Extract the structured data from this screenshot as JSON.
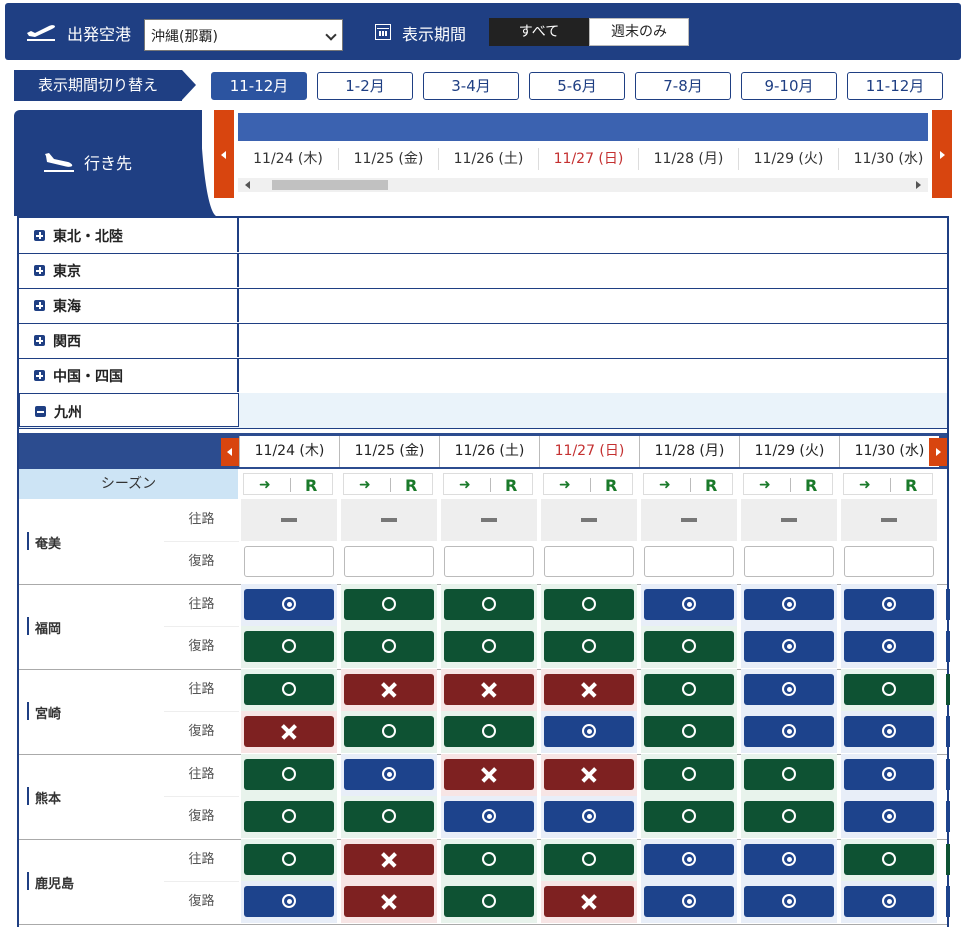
{
  "topbar": {
    "departure_label": "出発空港",
    "airport_value": "沖縄(那覇)",
    "period_label": "表示期間",
    "seg_all": "すべて",
    "seg_weekend": "週末のみ"
  },
  "period": {
    "label": "表示期間切り替え",
    "months": [
      "11-12月",
      "1-2月",
      "3-4月",
      "5-6月",
      "7-8月",
      "9-10月",
      "11-12月"
    ],
    "active_index": 0
  },
  "dest_head_label": "行き先",
  "dates": [
    {
      "label": "11/24 (木)",
      "holiday": false
    },
    {
      "label": "11/25 (金)",
      "holiday": false
    },
    {
      "label": "11/26 (土)",
      "holiday": false
    },
    {
      "label": "11/27 (日)",
      "holiday": true
    },
    {
      "label": "11/28 (月)",
      "holiday": false
    },
    {
      "label": "11/29 (火)",
      "holiday": false
    },
    {
      "label": "11/30 (水)",
      "holiday": false
    }
  ],
  "regions": [
    {
      "name": "東北・北陸",
      "open": false
    },
    {
      "name": "東京",
      "open": false
    },
    {
      "name": "東海",
      "open": false
    },
    {
      "name": "関西",
      "open": false
    },
    {
      "name": "中国・四国",
      "open": false
    },
    {
      "name": "九州",
      "open": true
    }
  ],
  "season_label": "シーズン",
  "season_r": "R",
  "direction_out": "往路",
  "direction_ret": "復路",
  "destinations": [
    {
      "name": "奄美",
      "out": [
        "dash",
        "dash",
        "dash",
        "dash",
        "dash",
        "dash",
        "dash"
      ],
      "ret": [
        "empty",
        "empty",
        "empty",
        "empty",
        "empty",
        "empty",
        "empty"
      ]
    },
    {
      "name": "福岡",
      "out": [
        "blue-dot",
        "green-o",
        "green-o",
        "green-o",
        "blue-dot",
        "blue-dot",
        "blue-dot"
      ],
      "ret": [
        "green-o",
        "green-o",
        "green-o",
        "green-o",
        "green-o",
        "blue-dot",
        "blue-dot"
      ]
    },
    {
      "name": "宮崎",
      "out": [
        "green-o",
        "red-x",
        "red-x",
        "red-x",
        "green-o",
        "blue-dot",
        "green-o"
      ],
      "ret": [
        "red-x",
        "green-o",
        "green-o",
        "blue-dot",
        "green-o",
        "blue-dot",
        "blue-dot"
      ]
    },
    {
      "name": "熊本",
      "out": [
        "green-o",
        "blue-dot",
        "red-x",
        "red-x",
        "green-o",
        "green-o",
        "blue-dot"
      ],
      "ret": [
        "green-o",
        "green-o",
        "blue-dot",
        "blue-dot",
        "green-o",
        "green-o",
        "blue-dot"
      ]
    },
    {
      "name": "鹿児島",
      "out": [
        "green-o",
        "red-x",
        "green-o",
        "green-o",
        "blue-dot",
        "blue-dot",
        "green-o"
      ],
      "ret": [
        "blue-dot",
        "red-x",
        "green-o",
        "red-x",
        "blue-dot",
        "blue-dot",
        "blue-dot"
      ]
    }
  ],
  "colors": {
    "navy": "#1f3f83",
    "status_blue": "#1d438c",
    "status_green": "#0e5233",
    "status_red": "#7e2121",
    "scroll_button": "#d8450f",
    "holiday_text": "#c43030"
  },
  "icons": {
    "departure": "plane-takeoff-icon",
    "arrival": "plane-landing-icon",
    "calendar": "calendar-icon"
  }
}
